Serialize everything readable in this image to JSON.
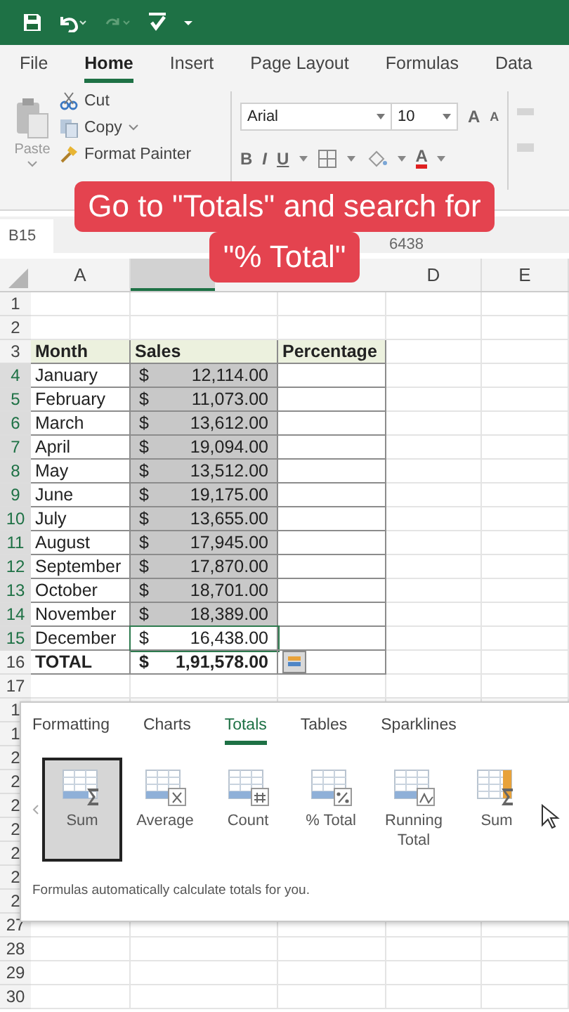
{
  "ribbon_tabs": [
    {
      "label": "File",
      "selected": false
    },
    {
      "label": "Home",
      "selected": true
    },
    {
      "label": "Insert",
      "selected": false
    },
    {
      "label": "Page Layout",
      "selected": false
    },
    {
      "label": "Formulas",
      "selected": false
    },
    {
      "label": "Data",
      "selected": false
    }
  ],
  "clipboard": {
    "paste": "Paste",
    "cut": "Cut",
    "copy": "Copy",
    "format_painter": "Format Painter"
  },
  "font": {
    "name": "Arial",
    "size": "10",
    "grow": "A",
    "shrink": "A",
    "bold": "B",
    "italic": "I",
    "underline": "U",
    "font_color": "A"
  },
  "formula_bar": {
    "name_box": "B15",
    "formula": "6438"
  },
  "columns": [
    {
      "label": "A",
      "selected": false
    },
    {
      "selected": true
    },
    {
      "label": "D",
      "selected": false
    },
    {
      "label": "E",
      "selected": false
    }
  ],
  "rows": [
    {
      "number": "1"
    },
    {
      "number": "2"
    },
    {
      "number": "3",
      "kind": "header",
      "cells": [
        "Month",
        "Sales",
        "Percentage"
      ]
    },
    {
      "number": "4",
      "kind": "data",
      "month": "January",
      "currency": "$",
      "amount": "12,114.00",
      "selected": true
    },
    {
      "number": "5",
      "kind": "data",
      "month": "February",
      "currency": "$",
      "amount": "11,073.00",
      "selected": true
    },
    {
      "number": "6",
      "kind": "data",
      "month": "March",
      "currency": "$",
      "amount": "13,612.00",
      "selected": true
    },
    {
      "number": "7",
      "kind": "data",
      "month": "April",
      "currency": "$",
      "amount": "19,094.00",
      "selected": true
    },
    {
      "number": "8",
      "kind": "data",
      "month": "May",
      "currency": "$",
      "amount": "13,512.00",
      "selected": true
    },
    {
      "number": "9",
      "kind": "data",
      "month": "June",
      "currency": "$",
      "amount": "19,175.00",
      "selected": true
    },
    {
      "number": "10",
      "kind": "data",
      "month": "July",
      "currency": "$",
      "amount": "13,655.00",
      "selected": true
    },
    {
      "number": "11",
      "kind": "data",
      "month": "August",
      "currency": "$",
      "amount": "17,945.00",
      "selected": true
    },
    {
      "number": "12",
      "kind": "data",
      "month": "September",
      "currency": "$",
      "amount": "17,870.00",
      "selected": true
    },
    {
      "number": "13",
      "kind": "data",
      "month": "October",
      "currency": "$",
      "amount": "18,701.00",
      "selected": true
    },
    {
      "number": "14",
      "kind": "data",
      "month": "November",
      "currency": "$",
      "amount": "18,389.00",
      "selected": true
    },
    {
      "number": "15",
      "kind": "data",
      "month": "December",
      "currency": "$",
      "amount": "16,438.00",
      "selected": false
    },
    {
      "number": "16",
      "kind": "total",
      "label": "TOTAL",
      "currency": "$",
      "amount": "1,91,578.00"
    },
    {
      "number": "17"
    },
    {
      "number": "1"
    },
    {
      "number": "1",
      "kind": "under_popup"
    },
    {
      "number": "2",
      "kind": "under_popup"
    },
    {
      "number": "2",
      "kind": "under_popup"
    },
    {
      "number": "2",
      "kind": "under_popup"
    },
    {
      "number": "2",
      "kind": "under_popup"
    },
    {
      "number": "2",
      "kind": "under_popup"
    },
    {
      "number": "2",
      "kind": "under_popup"
    },
    {
      "number": "2",
      "kind": "under_popup"
    },
    {
      "number": "27"
    },
    {
      "number": "28"
    },
    {
      "number": "29"
    },
    {
      "number": "30"
    }
  ],
  "quick_analysis": {
    "tabs": [
      {
        "label": "Formatting",
        "selected": false
      },
      {
        "label": "Charts",
        "selected": false
      },
      {
        "label": "Totals",
        "selected": true
      },
      {
        "label": "Tables",
        "selected": false
      },
      {
        "label": "Sparklines",
        "selected": false
      }
    ],
    "items": [
      {
        "label": "Sum",
        "kind": "sum",
        "selected": true
      },
      {
        "label": "Average",
        "kind": "average",
        "selected": false
      },
      {
        "label": "Count",
        "kind": "count",
        "selected": false
      },
      {
        "label": "% Total",
        "kind": "percent",
        "selected": false
      },
      {
        "label": "Running Total",
        "kind": "running",
        "selected": false
      },
      {
        "label": "Sum",
        "kind": "column_sum",
        "selected": false
      }
    ],
    "footer": "Formulas automatically calculate totals for you."
  },
  "caption": {
    "lines": [
      "Go to \"Totals\" and search for",
      "\"% Total\""
    ]
  }
}
